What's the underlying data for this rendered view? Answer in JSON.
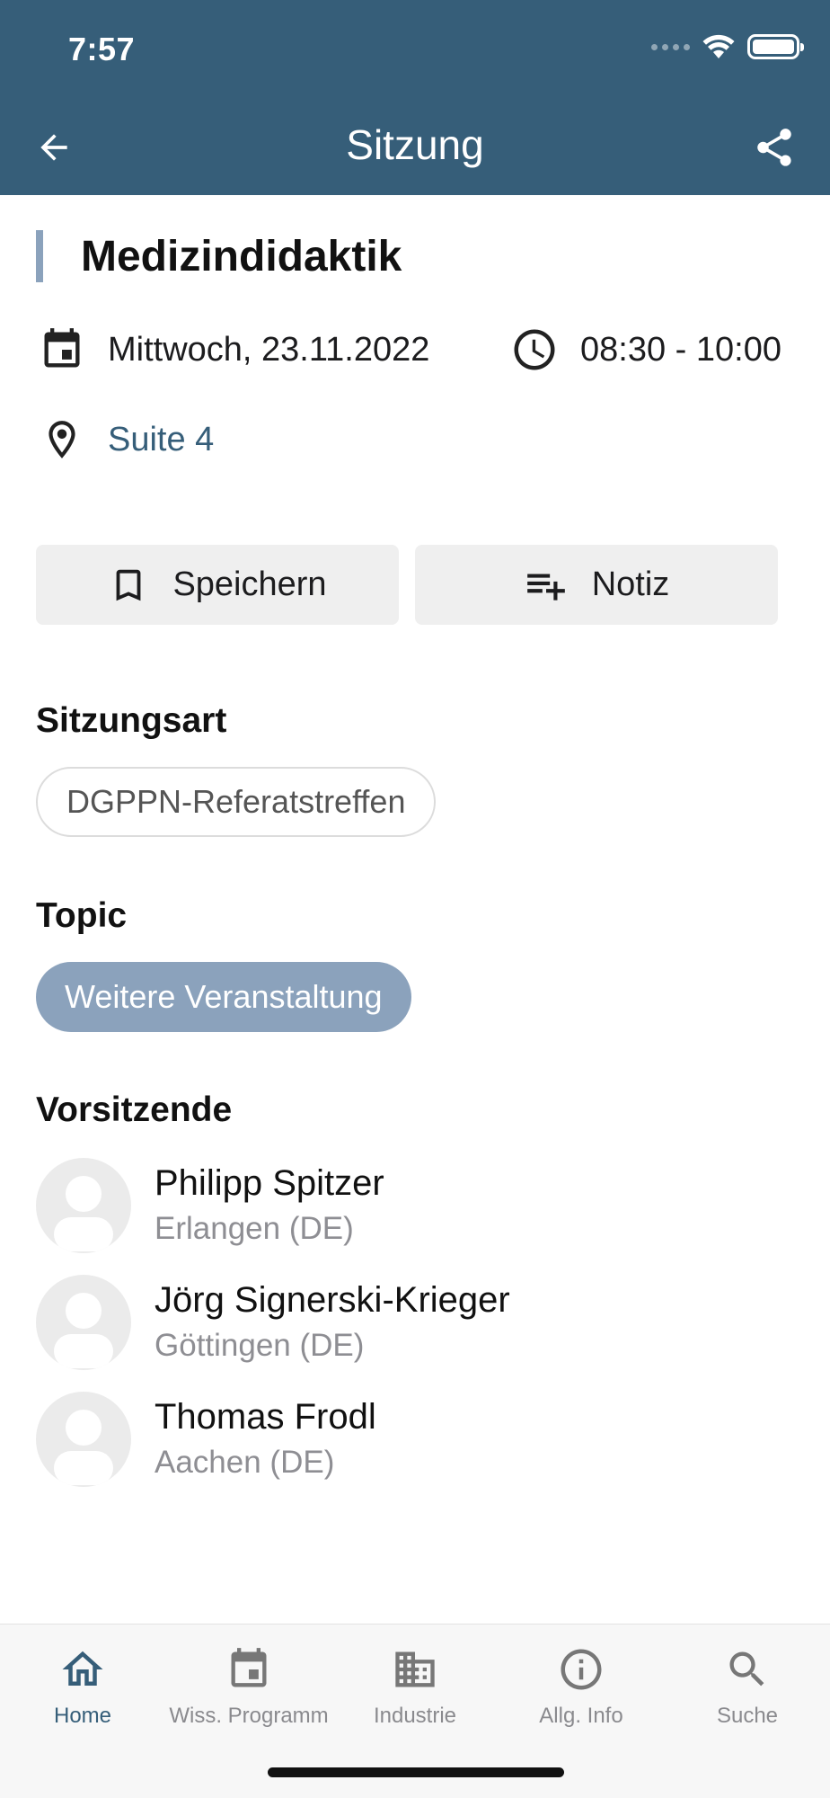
{
  "status_bar": {
    "time": "7:57"
  },
  "header": {
    "title": "Sitzung",
    "accent": "#365e79"
  },
  "session": {
    "title": "Medizindidaktik",
    "date": "Mittwoch, 23.11.2022",
    "time": "08:30 - 10:00",
    "location": "Suite 4"
  },
  "actions": {
    "save_label": "Speichern",
    "note_label": "Notiz"
  },
  "sections": {
    "type_label": "Sitzungsart",
    "type_value": "DGPPN-Referatstreffen",
    "topic_label": "Topic",
    "topic_value": "Weitere Veranstaltung",
    "chairs_label": "Vorsitzende"
  },
  "chairs": [
    {
      "name": "Philipp Spitzer",
      "location": "Erlangen (DE)"
    },
    {
      "name": "Jörg Signerski-Krieger",
      "location": "Göttingen (DE)"
    },
    {
      "name": "Thomas Frodl",
      "location": "Aachen (DE)"
    }
  ],
  "nav": [
    {
      "label": "Home",
      "icon": "home-icon",
      "active": true
    },
    {
      "label": "Wiss. Programm",
      "icon": "calendar-icon",
      "active": false
    },
    {
      "label": "Industrie",
      "icon": "building-icon",
      "active": false
    },
    {
      "label": "Allg. Info",
      "icon": "info-icon",
      "active": false
    },
    {
      "label": "Suche",
      "icon": "search-icon",
      "active": false
    }
  ]
}
